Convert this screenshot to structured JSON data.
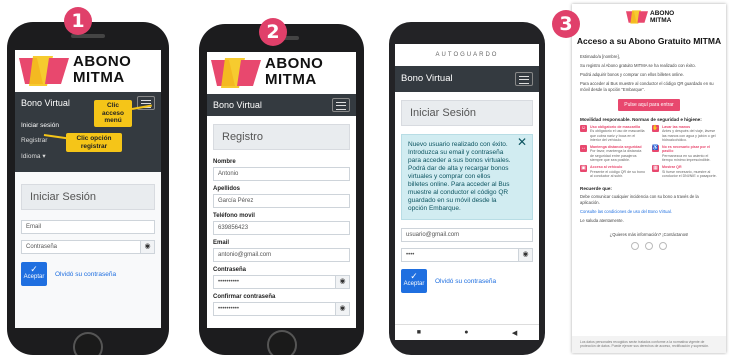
{
  "steps": [
    "1",
    "2",
    "3"
  ],
  "brand": {
    "line1": "ABONO",
    "line2": "MITMA",
    "color_pink": "#e8486e",
    "color_yellow": "#f5c518"
  },
  "phone1": {
    "navbar_title": "Bono Virtual",
    "menu": [
      "Iniciar sesión",
      "Registrar",
      "Idioma ▾"
    ],
    "callout_menu": "Clic\nacceso\nmenú",
    "callout_register": "Clic opción\nregistrar",
    "login_title": "Iniciar Sesión",
    "email_placeholder": "Email",
    "password_placeholder": "Contraseña",
    "submit_label": "Aceptar",
    "forgot_link": "Olvidó su contraseña"
  },
  "phone2": {
    "navbar_title": "Bono Virtual",
    "form_title": "Registro",
    "fields": [
      {
        "label": "Nombre",
        "value": "Antonio"
      },
      {
        "label": "Apellidos",
        "value": "García Pérez"
      },
      {
        "label": "Teléfono movil",
        "value": "639856423"
      },
      {
        "label": "Email",
        "value": "antonio@gmail.com"
      },
      {
        "label": "Contraseña",
        "value": "••••••••••"
      },
      {
        "label": "Confirmar contraseña",
        "value": "••••••••••"
      }
    ]
  },
  "phone3": {
    "header_caption": "AUTOGUARDO",
    "navbar_title": "Bono Virtual",
    "login_title": "Iniciar Sesión",
    "alert_text": "Nuevo usuario realizado con éxito. Introduzca su email y contraseña para acceder a sus bonos virtuales. Podrá dar de alta y recargar bonos virtuales y comprar con ellos billetes online. Para acceder al Bus muestre al conductor el código QR guardado en su móvil desde la opción Embarque.",
    "email_value": "usuario@gmail.com",
    "password_value": "••••",
    "submit_label": "Aceptar",
    "forgot_link": "Olvidó su contraseña"
  },
  "email": {
    "title": "Acceso a su Abono Gratuito MITMA",
    "greeting": "Estimado/a [nombre],",
    "p1": "Su registro al Abono gratuito MITMA se ha realizado con éxito.",
    "p2": "Podrá adquirir bonos y comprar con ellos billetes online.",
    "p3": "Para acceder al Bus muestre al conductor el código QR guardado en su móvil desde la opción \"Embarque\".",
    "button": "Pulse aquí para entrar",
    "rules_heading": "Movilidad responsable. Normas de seguridad e higiene:",
    "rules": [
      {
        "title": "Uso obligatorio de mascarilla",
        "text": "Es obligatorio el uso de mascarilla que cubra nariz y boca en el interior del vehículo."
      },
      {
        "title": "Lavar las manos",
        "text": "Antes y después del viaje, lávese las manos con agua y jabón o gel hidroalcohólico."
      },
      {
        "title": "Mantenga distancia seguridad",
        "text": "Por favor, mantenga la distancia de seguridad entre pasajeros siempre que sea posible."
      },
      {
        "title": "No es necesario pisar por el pasillo",
        "text": "Permanezca en su asiento el tiempo mínimo imprescindible."
      },
      {
        "title": "Acceso al vehículo",
        "text": "Presente el código QR de su bono al conductor al subir."
      },
      {
        "title": "Mostrar QR",
        "text": "Si fuese necesario, muestre al conductor el DNI/NIE o pasaporte."
      }
    ],
    "remember_heading": "Recuerde que:",
    "remember_text": "Debe comunicar cualquier incidencia con su bono a través de la aplicación.",
    "conditions_link": "Consulte las condiciones de uso del Bono Virtual.",
    "goodbye": "Le saluda atentamente.",
    "questions": "¿Quieres más información? ¡Contáctanos!",
    "footer": "Los datos personales recogidos serán tratados conforme a la normativa vigente de protección de datos. Puede ejercer sus derechos de acceso, rectificación y supresión."
  }
}
